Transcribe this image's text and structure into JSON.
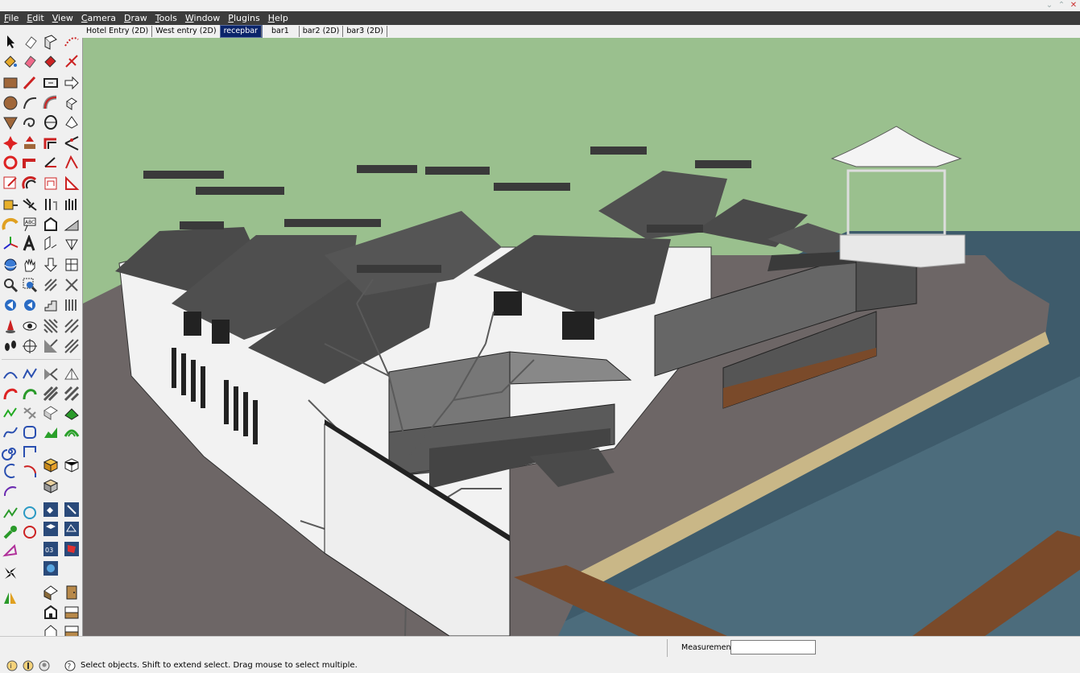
{
  "menubar": {
    "items": [
      "File",
      "Edit",
      "View",
      "Camera",
      "Draw",
      "Tools",
      "Window",
      "Plugins",
      "Help"
    ]
  },
  "window_controls": {
    "minimize": "⌄",
    "maximize": "⌃",
    "close": "✕"
  },
  "scene_tabs": [
    {
      "label": "Hotel Entry (2D)",
      "active": false
    },
    {
      "label": "West entry (2D)",
      "active": false
    },
    {
      "label": "recepbar",
      "active": true
    },
    {
      "label": "bar1",
      "active": false
    },
    {
      "label": "bar2  (2D)",
      "active": false
    },
    {
      "label": "bar3 (2D)",
      "active": false
    }
  ],
  "measurements": {
    "label": "Measurements",
    "value": ""
  },
  "status": {
    "text": "Select objects. Shift to extend select. Drag mouse to select multiple."
  },
  "colors": {
    "sky": "#9ac08e",
    "ground": "#6e6767",
    "water": "#3d5a6a",
    "roof": "#4a4a4a",
    "wall": "#f2f2f2",
    "menubar": "#3c3c3c",
    "active_tab": "#0a246a"
  }
}
